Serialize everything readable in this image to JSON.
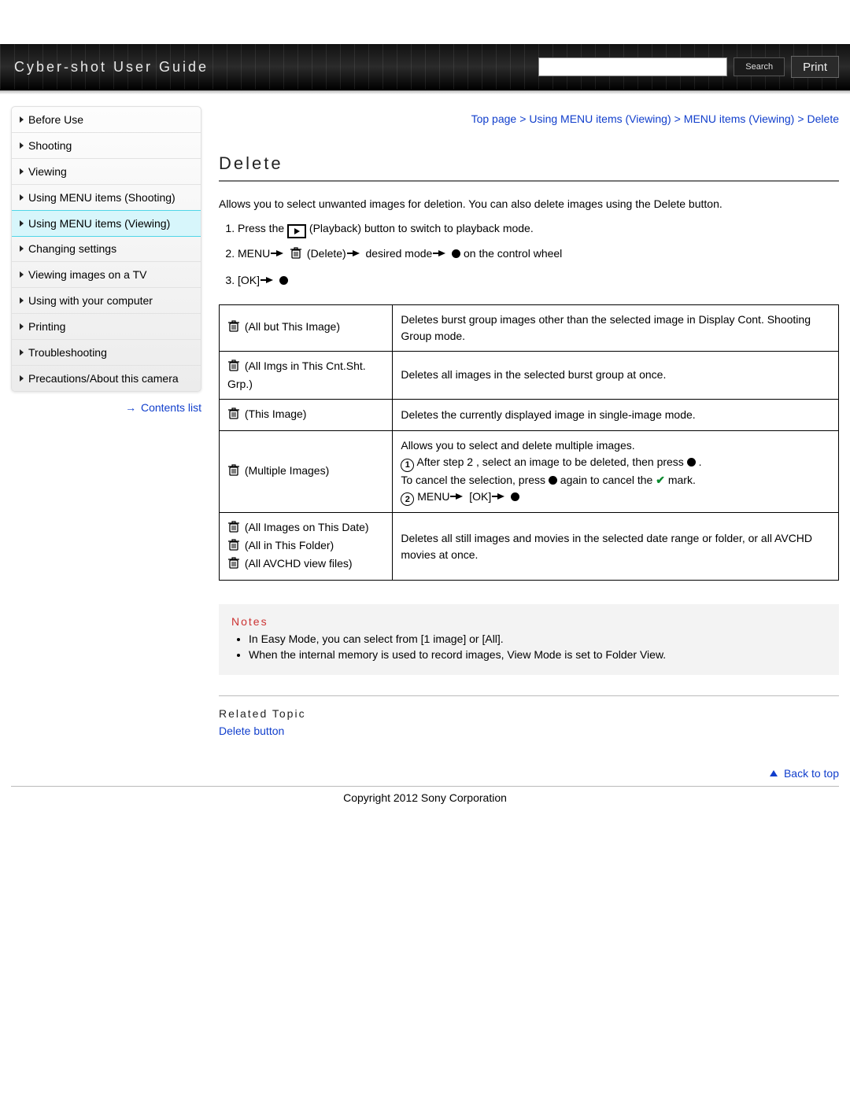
{
  "header": {
    "title": "Cyber-shot User Guide",
    "search_button": "Search",
    "print_button": "Print"
  },
  "sidebar": {
    "items": [
      {
        "label": "Before Use"
      },
      {
        "label": "Shooting"
      },
      {
        "label": "Viewing"
      },
      {
        "label": "Using MENU items (Shooting)"
      },
      {
        "label": "Using MENU items (Viewing)",
        "active": true
      },
      {
        "label": "Changing settings"
      },
      {
        "label": "Viewing images on a TV"
      },
      {
        "label": "Using with your computer"
      },
      {
        "label": "Printing"
      },
      {
        "label": "Troubleshooting"
      },
      {
        "label": "Precautions/About this camera"
      }
    ],
    "contents_list": "Contents list"
  },
  "breadcrumb": {
    "parts": [
      "Top page",
      "Using MENU items (Viewing)",
      "MENU items (Viewing)",
      "Delete"
    ]
  },
  "page_title": "Delete",
  "intro": "Allows you to select unwanted images for deletion. You can also delete images using the Delete button.",
  "steps": {
    "s1_a": "Press the ",
    "s1_b": " (Playback) button to switch to playback mode.",
    "s2_a": "MENU ",
    "s2_b": " (Delete) ",
    "s2_c": " desired mode ",
    "s2_d": " on the control wheel",
    "s3_a": "[OK] "
  },
  "table": {
    "r1_label": " (All but This Image)",
    "r1_desc": "Deletes burst group images other than the selected image in Display Cont. Shooting Group mode.",
    "r2_label": " (All Imgs in This Cnt.Sht. Grp.)",
    "r2_desc": "Deletes all images in the selected burst group at once.",
    "r3_label": " (This Image)",
    "r3_desc": "Deletes the currently displayed image in single-image mode.",
    "r4_label": " (Multiple Images)",
    "r4_desc_a": "Allows you to select and delete multiple images.",
    "r4_desc_b": " After step 2 , select an image to be deleted, then press ",
    "r4_desc_c": "To cancel the selection, press ",
    "r4_desc_d": " again to cancel the ",
    "r4_desc_e": " mark.",
    "r4_desc_f": " MENU ",
    "r4_desc_g": " [OK] ",
    "r5_label_a": " (All Images on This Date)",
    "r5_label_b": " (All in This Folder)",
    "r5_label_c": " (All AVCHD view files)",
    "r5_desc": "Deletes all still images and movies in the selected date range or folder, or all AVCHD movies at once."
  },
  "notes": {
    "title": "Notes",
    "items": [
      "In Easy Mode, you can select from [1 image] or [All].",
      "When the internal memory is used to record images, View Mode is set to Folder View."
    ]
  },
  "related": {
    "title": "Related Topic",
    "link": "Delete button"
  },
  "back_to_top": "Back to top",
  "footer": "Copyright 2012 Sony Corporation"
}
